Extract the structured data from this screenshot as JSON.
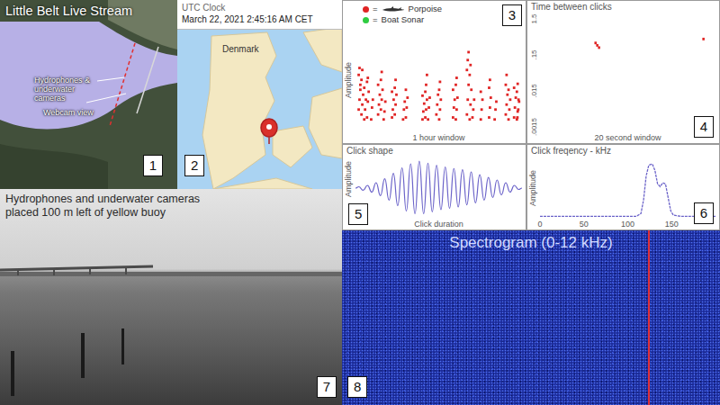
{
  "map": {
    "title": "Little Belt Live Stream",
    "labels": [
      "Hydrophones & underwater cameras",
      "Webcam view"
    ],
    "number": "1"
  },
  "clock": {
    "label": "UTC Clock",
    "time": "March 22, 2021 2:45:16 AM CET",
    "country": "Denmark",
    "number": "2"
  },
  "clicks": {
    "legend": [
      {
        "symbol": "=",
        "label": "Porpoise",
        "color": "#e02424",
        "kind": "icon"
      },
      {
        "symbol": "=",
        "label": "Boat Sonar",
        "color": "#2ecc40",
        "kind": "text"
      }
    ],
    "y_label": "Amplitude",
    "x_label": "1 hour window",
    "x_max": 60,
    "streaks": [
      {
        "x": 1,
        "y": [
          0.2,
          0.3,
          0.45,
          0.55,
          0.62,
          0.4
        ]
      },
      {
        "x": 2,
        "y": [
          0.15,
          0.25,
          0.35,
          0.5,
          0.6
        ]
      },
      {
        "x": 3,
        "y": [
          0.1,
          0.2,
          0.3,
          0.42
        ]
      },
      {
        "x": 4,
        "y": [
          0.12,
          0.28,
          0.38,
          0.48,
          0.52
        ]
      },
      {
        "x": 5.5,
        "y": [
          0.1,
          0.22,
          0.3
        ]
      },
      {
        "x": 8,
        "y": [
          0.15,
          0.25,
          0.35,
          0.45
        ]
      },
      {
        "x": 9,
        "y": [
          0.2,
          0.3,
          0.4,
          0.5,
          0.58
        ]
      },
      {
        "x": 10,
        "y": [
          0.1,
          0.18,
          0.28
        ]
      },
      {
        "x": 13,
        "y": [
          0.12,
          0.2,
          0.3,
          0.38
        ]
      },
      {
        "x": 14,
        "y": [
          0.15,
          0.25,
          0.35,
          0.42,
          0.5
        ]
      },
      {
        "x": 17,
        "y": [
          0.1,
          0.2,
          0.28
        ]
      },
      {
        "x": 18,
        "y": [
          0.12,
          0.22,
          0.32,
          0.4
        ]
      },
      {
        "x": 24,
        "y": [
          0.1,
          0.18,
          0.26,
          0.34
        ]
      },
      {
        "x": 25,
        "y": [
          0.12,
          0.2,
          0.3,
          0.38,
          0.45,
          0.55
        ]
      },
      {
        "x": 26,
        "y": [
          0.1,
          0.22,
          0.32
        ]
      },
      {
        "x": 29,
        "y": [
          0.15,
          0.25,
          0.35
        ]
      },
      {
        "x": 30,
        "y": [
          0.1,
          0.2,
          0.3,
          0.4,
          0.48
        ]
      },
      {
        "x": 35,
        "y": [
          0.12,
          0.22,
          0.3,
          0.4
        ]
      },
      {
        "x": 36,
        "y": [
          0.1,
          0.2,
          0.32,
          0.45,
          0.52
        ]
      },
      {
        "x": 40,
        "y": [
          0.15,
          0.3,
          0.45,
          0.6,
          0.7,
          0.78
        ]
      },
      {
        "x": 41,
        "y": [
          0.1,
          0.25,
          0.4,
          0.55,
          0.65
        ]
      },
      {
        "x": 42,
        "y": [
          0.12,
          0.2,
          0.3
        ]
      },
      {
        "x": 45,
        "y": [
          0.1,
          0.2,
          0.3,
          0.38
        ]
      },
      {
        "x": 48,
        "y": [
          0.12,
          0.22,
          0.32,
          0.42,
          0.5
        ]
      },
      {
        "x": 50,
        "y": [
          0.1,
          0.2,
          0.28
        ]
      },
      {
        "x": 54,
        "y": [
          0.15,
          0.25,
          0.35,
          0.45,
          0.55
        ]
      },
      {
        "x": 55,
        "y": [
          0.1,
          0.2,
          0.3,
          0.4
        ]
      },
      {
        "x": 57,
        "y": [
          0.12,
          0.22,
          0.32,
          0.42
        ]
      },
      {
        "x": 58,
        "y": [
          0.1,
          0.18,
          0.3,
          0.38,
          0.46
        ]
      },
      {
        "x": 59,
        "y": [
          0.12,
          0.2,
          0.28
        ]
      }
    ],
    "number": "3"
  },
  "intervals": {
    "title": "Time between clicks",
    "y_ticks": [
      {
        "label": "1.5",
        "value": 1.5
      },
      {
        "label": ".15",
        "value": 0.15
      },
      {
        "label": ".015",
        "value": 0.015
      },
      {
        "label": ".0015",
        "value": 0.0015
      }
    ],
    "x_label": "20 second window",
    "x_max": 20,
    "points": [
      {
        "x": 6.2,
        "y": 0.35
      },
      {
        "x": 6.4,
        "y": 0.3
      },
      {
        "x": 6.6,
        "y": 0.26
      },
      {
        "x": 18.5,
        "y": 0.45
      }
    ],
    "number": "4"
  },
  "shape": {
    "title": "Click shape",
    "y_label": "Amplitude",
    "x_label": "Click duration",
    "peaks": [
      0.05,
      -0.08,
      0.1,
      -0.15,
      0.2,
      -0.28,
      0.35,
      -0.45,
      0.55,
      -0.65,
      0.75,
      -0.85,
      0.9,
      -0.95,
      1,
      -0.95,
      0.92,
      -0.88,
      0.85,
      -0.8,
      0.78,
      -0.75,
      0.72,
      -0.7,
      0.68,
      -0.62,
      0.6,
      -0.55,
      0.5,
      -0.45,
      0.4,
      -0.35,
      0.3,
      -0.25,
      0.2,
      -0.15,
      0.1,
      -0.05
    ],
    "number": "5"
  },
  "spectrum": {
    "title": "Click freqency - kHz",
    "y_label": "Amplitude",
    "x_ticks": [
      {
        "label": "0",
        "value": 0
      },
      {
        "label": "50",
        "value": 50
      },
      {
        "label": "100",
        "value": 100
      },
      {
        "label": "150",
        "value": 150
      }
    ],
    "x_max": 200,
    "points": [
      [
        0,
        0
      ],
      [
        110,
        0
      ],
      [
        115,
        0.05
      ],
      [
        118,
        0.3
      ],
      [
        121,
        0.75
      ],
      [
        124,
        0.95
      ],
      [
        128,
        0.97
      ],
      [
        131,
        0.85
      ],
      [
        134,
        0.6
      ],
      [
        137,
        0.55
      ],
      [
        140,
        0.62
      ],
      [
        143,
        0.6
      ],
      [
        146,
        0.35
      ],
      [
        149,
        0.1
      ],
      [
        152,
        0.02
      ],
      [
        160,
        0
      ],
      [
        200,
        0
      ]
    ],
    "number": "6"
  },
  "webcam": {
    "caption": [
      "Hydrophones and underwater cameras",
      "placed 100 m left of yellow buoy"
    ],
    "number": "7"
  },
  "spectrogram": {
    "title": "Spectrogram (0-12 kHz)",
    "cursor": {
      "level": 0.81
    },
    "number": "8"
  }
}
